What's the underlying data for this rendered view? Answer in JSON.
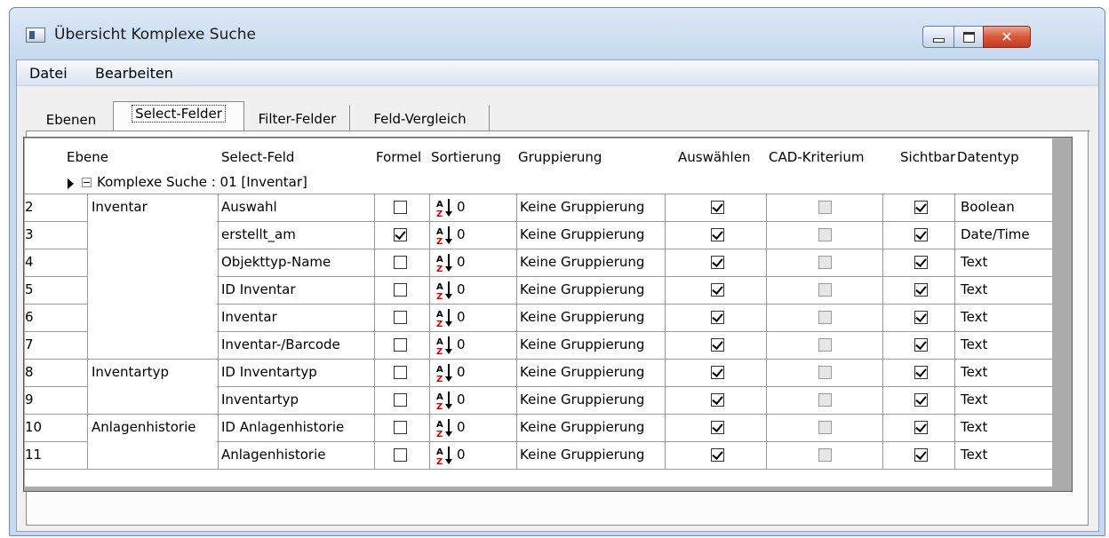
{
  "window": {
    "title": "Übersicht Komplexe Suche"
  },
  "menu": {
    "items": [
      "Datei",
      "Bearbeiten"
    ]
  },
  "tabs": [
    "Ebenen",
    "Select-Felder",
    "Filter-Felder",
    "Feld-Vergleich"
  ],
  "active_tab": "Select-Felder",
  "grid": {
    "headers": {
      "ebene": "Ebene",
      "select_feld": "Select-Feld",
      "formel": "Formel",
      "sortierung": "Sortierung",
      "gruppierung": "Gruppierung",
      "auswaehlen": "Auswählen",
      "cad": "CAD-Kriterium",
      "sichtbar": "Sichtbar",
      "datentyp": "Datentyp"
    },
    "group_label": "Komplexe Suche : 01 [Inventar]",
    "rows": [
      {
        "n": "2",
        "ebene": "Inventar",
        "feld": "Auswahl",
        "formel": false,
        "sort": "0",
        "gruppierung": "Keine Gruppierung",
        "auswaehlen": true,
        "sichtbar": true,
        "datentyp": "Boolean"
      },
      {
        "n": "3",
        "ebene": "",
        "feld": "erstellt_am",
        "formel": true,
        "sort": "0",
        "gruppierung": "Keine Gruppierung",
        "auswaehlen": true,
        "sichtbar": true,
        "datentyp": "Date/Time"
      },
      {
        "n": "4",
        "ebene": "",
        "feld": "Objekttyp-Name",
        "formel": false,
        "sort": "0",
        "gruppierung": "Keine Gruppierung",
        "auswaehlen": true,
        "sichtbar": true,
        "datentyp": "Text"
      },
      {
        "n": "5",
        "ebene": "",
        "feld": "ID Inventar",
        "formel": false,
        "sort": "0",
        "gruppierung": "Keine Gruppierung",
        "auswaehlen": true,
        "sichtbar": true,
        "datentyp": "Text"
      },
      {
        "n": "6",
        "ebene": "",
        "feld": "Inventar",
        "formel": false,
        "sort": "0",
        "gruppierung": "Keine Gruppierung",
        "auswaehlen": true,
        "sichtbar": true,
        "datentyp": "Text"
      },
      {
        "n": "7",
        "ebene": "",
        "feld": "Inventar-/Barcode",
        "formel": false,
        "sort": "0",
        "gruppierung": "Keine Gruppierung",
        "auswaehlen": true,
        "sichtbar": true,
        "datentyp": "Text"
      },
      {
        "n": "8",
        "ebene": "Inventartyp",
        "feld": "ID Inventartyp",
        "formel": false,
        "sort": "0",
        "gruppierung": "Keine Gruppierung",
        "auswaehlen": true,
        "sichtbar": true,
        "datentyp": "Text"
      },
      {
        "n": "9",
        "ebene": "",
        "feld": "Inventartyp",
        "formel": false,
        "sort": "0",
        "gruppierung": "Keine Gruppierung",
        "auswaehlen": true,
        "sichtbar": true,
        "datentyp": "Text"
      },
      {
        "n": "10",
        "ebene": "Anlagenhistorie",
        "feld": "ID Anlagenhistorie",
        "formel": false,
        "sort": "0",
        "gruppierung": "Keine Gruppierung",
        "auswaehlen": true,
        "sichtbar": true,
        "datentyp": "Text"
      },
      {
        "n": "11",
        "ebene": "",
        "feld": "Anlagenhistorie",
        "formel": false,
        "sort": "0",
        "gruppierung": "Keine Gruppierung",
        "auswaehlen": true,
        "sichtbar": true,
        "datentyp": "Text"
      }
    ]
  }
}
